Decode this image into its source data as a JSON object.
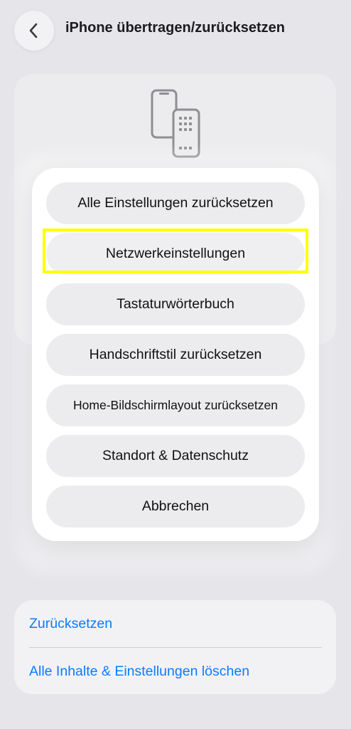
{
  "header": {
    "title": "iPhone übertragen/zurücksetzen",
    "back_icon": "chevron-left-icon"
  },
  "top_card": {
    "icon": "transfer-phones-icon"
  },
  "action_menu": {
    "items": [
      {
        "label": "Alle Einstellungen zurücksetzen"
      },
      {
        "label": "Netzwerkeinstellungen"
      },
      {
        "label": "Tastaturwörterbuch"
      },
      {
        "label": "Handschriftstil zurücksetzen"
      },
      {
        "label": "Home-Bildschirmlayout zurücksetzen"
      },
      {
        "label": "Standort & Datenschutz"
      },
      {
        "label": "Abbrechen"
      }
    ]
  },
  "bottom_card": {
    "reset_label": "Zurücksetzen",
    "erase_label": "Alle Inhalte & Einstellungen löschen"
  },
  "colors": {
    "background": "#e5e5ea",
    "link": "#0a7bff",
    "highlight": "#ffff00"
  }
}
